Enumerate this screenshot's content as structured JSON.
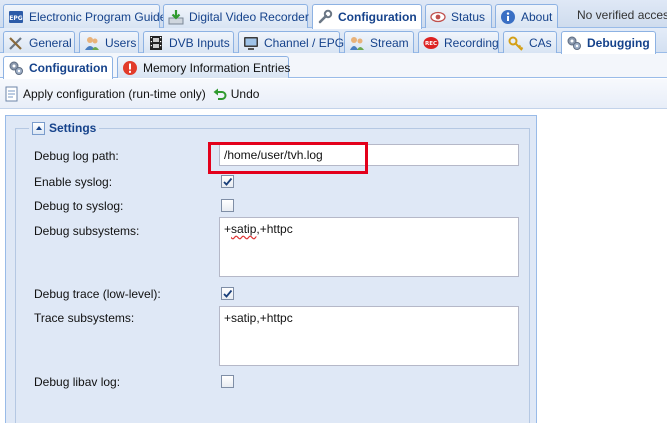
{
  "top_tabs": [
    {
      "label": "Electronic Program Guide",
      "icon": "epg-icon"
    },
    {
      "label": "Digital Video Recorder",
      "icon": "download-icon"
    },
    {
      "label": "Configuration",
      "icon": "wrench-icon",
      "active": true
    },
    {
      "label": "Status",
      "icon": "eye-icon"
    },
    {
      "label": "About",
      "icon": "info-icon"
    }
  ],
  "status_text": "No verified access",
  "config_tabs": [
    {
      "label": "General",
      "icon": "tools-icon"
    },
    {
      "label": "Users",
      "icon": "users-icon"
    },
    {
      "label": "DVB Inputs",
      "icon": "film-icon"
    },
    {
      "label": "Channel / EPG",
      "icon": "tv-icon"
    },
    {
      "label": "Stream",
      "icon": "stream-icon"
    },
    {
      "label": "Recording",
      "icon": "rec-icon"
    },
    {
      "label": "CAs",
      "icon": "key-icon"
    },
    {
      "label": "Debugging",
      "icon": "gears-icon",
      "active": true
    }
  ],
  "debug_tabs": [
    {
      "label": "Configuration",
      "icon": "gears-icon",
      "active": true
    },
    {
      "label": "Memory Information Entries",
      "icon": "warning-icon"
    }
  ],
  "toolbar": {
    "apply_label": "Apply configuration (run-time only)",
    "undo_label": "Undo"
  },
  "settings": {
    "legend": "Settings",
    "debug_log_path_label": "Debug log path:",
    "debug_log_path_value": "/home/user/tvh.log",
    "enable_syslog_label": "Enable syslog:",
    "enable_syslog_checked": true,
    "debug_to_syslog_label": "Debug to syslog:",
    "debug_to_syslog_checked": false,
    "debug_subsystems_label": "Debug subsystems:",
    "debug_subsystems_prefix": "+",
    "debug_subsystems_word": "satip",
    "debug_subsystems_rest": ",+httpc",
    "debug_trace_label": "Debug trace (low-level):",
    "debug_trace_checked": true,
    "trace_subsystems_label": "Trace subsystems:",
    "trace_subsystems_value": "+satip,+httpc",
    "debug_libav_label": "Debug libav log:",
    "debug_libav_checked": false
  },
  "colors": {
    "accent": "#15428b",
    "highlight": "#e3001b",
    "panel_bg": "#dfe8f6"
  }
}
